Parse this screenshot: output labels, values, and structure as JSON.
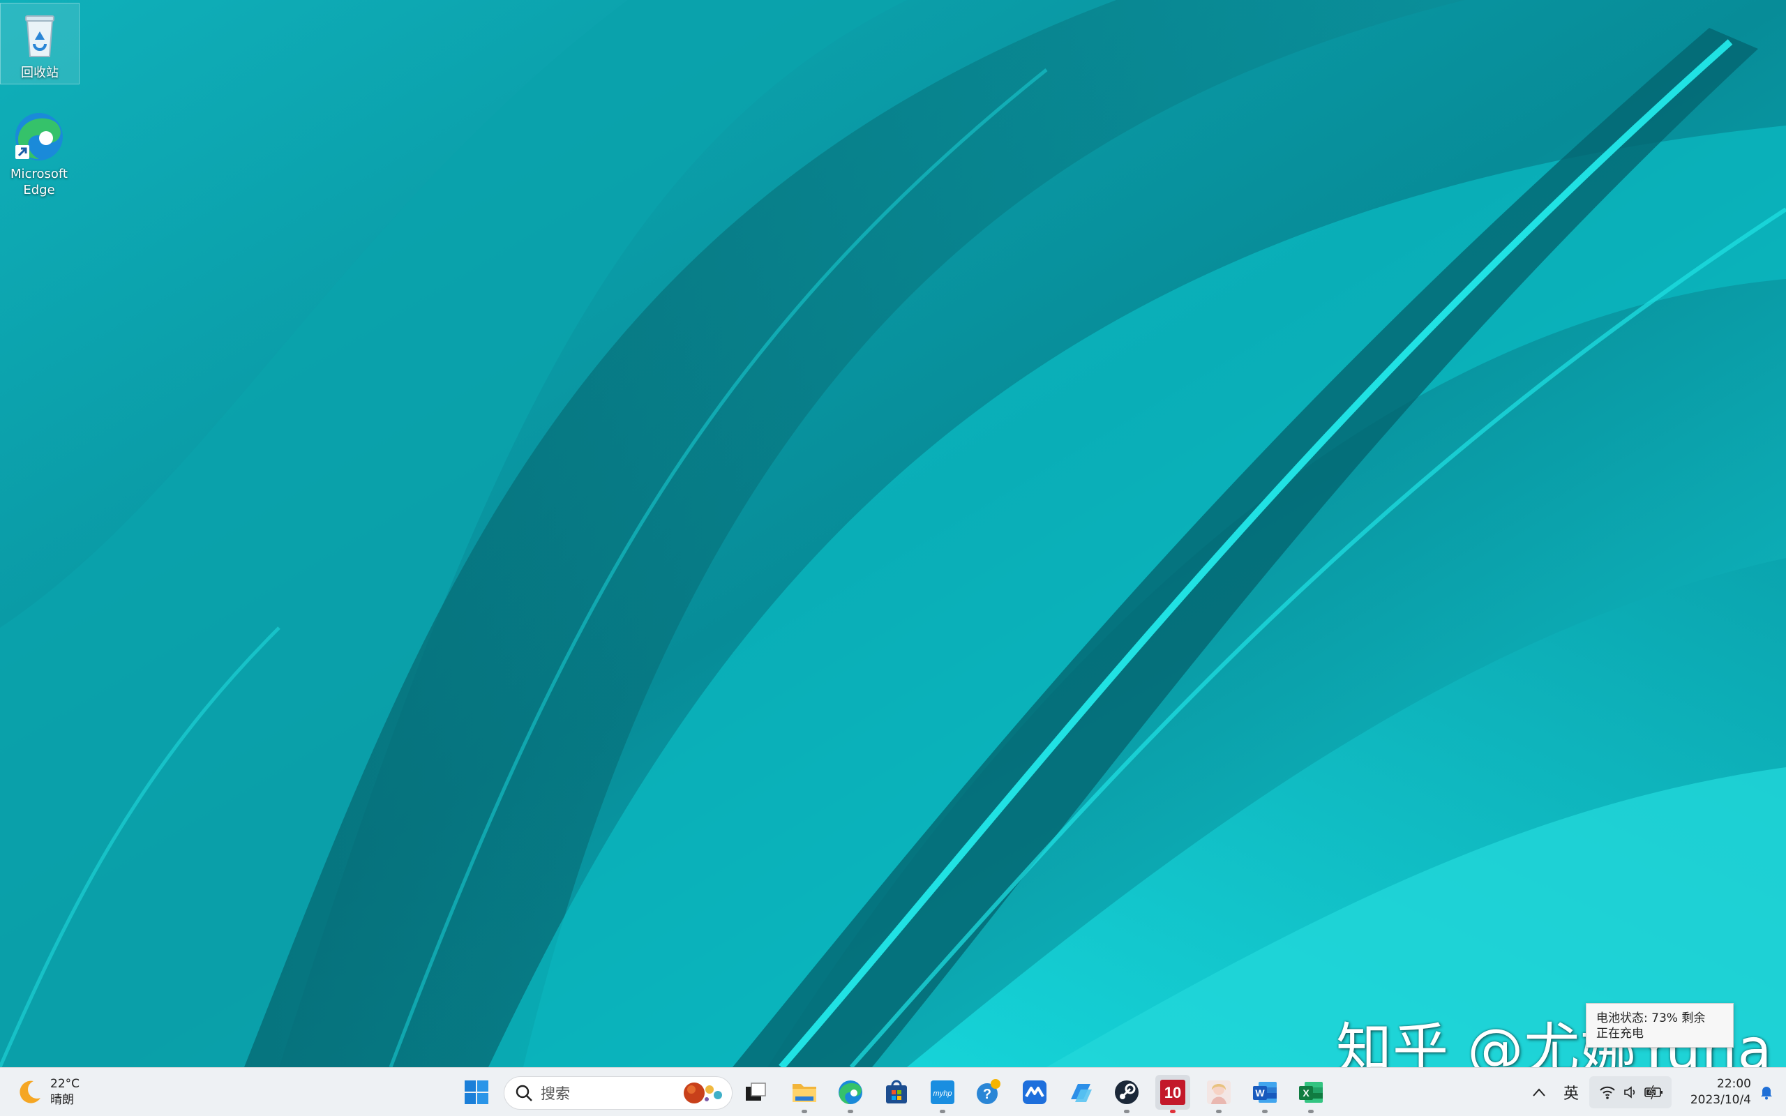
{
  "desktop": {
    "icons": [
      {
        "name": "recycle-bin",
        "label": "回收站"
      },
      {
        "name": "microsoft-edge",
        "label_line1": "Microsoft",
        "label_line2": "Edge"
      }
    ]
  },
  "watermark": {
    "text": "知乎 @尤娜Yuna"
  },
  "battery_tooltip": {
    "line1": "电池状态: 73% 剩余",
    "line2": "正在充电"
  },
  "taskbar": {
    "weather": {
      "temperature": "22°C",
      "condition": "晴朗",
      "icon": "moon-icon"
    },
    "search": {
      "placeholder": "搜索"
    },
    "apps": [
      {
        "name": "task-view",
        "icon": "task-view-icon"
      },
      {
        "name": "file-explorer",
        "icon": "folder-icon"
      },
      {
        "name": "edge",
        "icon": "edge-icon"
      },
      {
        "name": "microsoft-store",
        "icon": "store-icon"
      },
      {
        "name": "myhp",
        "icon": "myhp-icon",
        "label": "myhp"
      },
      {
        "name": "get-help",
        "icon": "help-icon"
      },
      {
        "name": "tencent-meeting",
        "icon": "meeting-icon"
      },
      {
        "name": "copilot",
        "icon": "copilot-icon"
      },
      {
        "name": "steam",
        "icon": "steam-icon"
      },
      {
        "name": "app-10",
        "icon": "ten-icon",
        "label": "10"
      },
      {
        "name": "anime-app",
        "icon": "anime-icon"
      },
      {
        "name": "word",
        "icon": "word-icon",
        "label": "W"
      },
      {
        "name": "excel",
        "icon": "excel-icon",
        "label": "X"
      }
    ],
    "tray": {
      "ime": "英",
      "time": "22:00",
      "date": "2023/10/4"
    }
  }
}
